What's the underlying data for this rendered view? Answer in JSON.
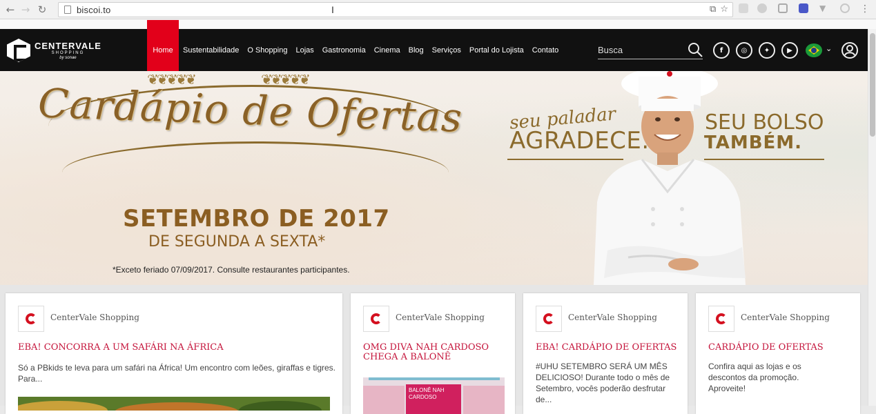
{
  "browser": {
    "url": "biscoi.to",
    "back_icon": "back-arrow-icon",
    "forward_icon": "forward-arrow-icon",
    "reload_icon": "reload-icon"
  },
  "site": {
    "logo": {
      "name": "CENTERVALE",
      "sub": "SHOPPING",
      "tag": "by sonae"
    },
    "nav": [
      "Home",
      "Sustentabilidade",
      "O Shopping",
      "Lojas",
      "Gastronomia",
      "Cinema",
      "Blog",
      "Serviços",
      "Portal do Lojista",
      "Contato"
    ],
    "active_nav": "Home",
    "search": {
      "placeholder": "Busca",
      "value": ""
    },
    "socials": [
      "facebook-icon",
      "instagram-icon",
      "twitter-icon",
      "youtube-icon"
    ],
    "language_flag": "brazil-flag-icon"
  },
  "hero": {
    "title": "Cardápio de Ofertas",
    "month": "SETEMBRO DE 2017",
    "days": "DE SEGUNDA A SEXTA*",
    "footnote": "*Exceto feriado 07/09/2017. Consulte restaurantes participantes.",
    "tagline1a": "seu paladar",
    "tagline1b": "AGRADECE.",
    "tagline2a": "SEU BOLSO",
    "tagline2b": "TAMBÉM."
  },
  "cards": [
    {
      "source": "CenterVale Shopping",
      "title": "EBA! CONCORRA A UM SAFÁRI NA ÁFRICA",
      "excerpt": "Só a PBkids te leva para um safári na África! Um encontro com leões, giraffas e tigres. Para..."
    },
    {
      "source": "CenterVale Shopping",
      "title": "OMG DIVA NAH CARDOSO CHEGA A BALONÊ",
      "excerpt": "",
      "thumb_text": "BALONÊ NAH CARDOSO"
    },
    {
      "source": "CenterVale Shopping",
      "title": "EBA! CARDÁPIO DE OFERTAS",
      "excerpt": "#UHU SETEMBRO SERÁ UM MÊS DELICIOSO! Durante todo o mês de Setembro, vocês poderão desfrutar de..."
    },
    {
      "source": "CenterVale Shopping",
      "title": "CARDÁPIO DE OFERTAS",
      "excerpt": "Confira aqui as lojas e os descontos da promoção. Aproveite!"
    }
  ]
}
